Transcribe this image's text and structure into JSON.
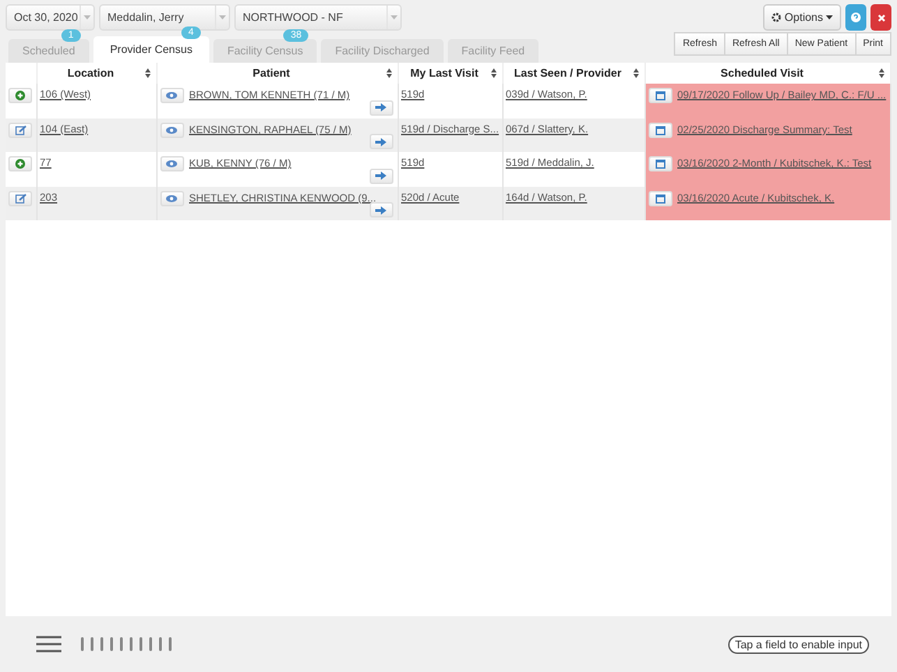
{
  "filters": [
    {
      "value": "Oct 30, 2020"
    },
    {
      "value": "Meddalin, Jerry"
    },
    {
      "value": "NORTHWOOD - NF"
    }
  ],
  "options_button": "Options",
  "tabs": [
    {
      "label": "Scheduled",
      "badge": "1",
      "selected": false
    },
    {
      "label": "Provider Census",
      "badge": "4",
      "selected": true
    },
    {
      "label": "Facility Census",
      "badge": "38",
      "selected": false
    },
    {
      "label": "Facility Discharged",
      "selected": false
    },
    {
      "label": "Facility Feed",
      "selected": false
    }
  ],
  "actions": [
    "Refresh",
    "Refresh All",
    "New Patient",
    "Print"
  ],
  "table": {
    "columns": [
      "Location",
      "Patient",
      "My Last Visit",
      "Last Seen / Provider",
      "Scheduled Visit"
    ],
    "rows": [
      {
        "kind": "add",
        "location": "106 (West)",
        "patient": "BROWN, TOM KENNETH (71 / M)",
        "my_last_visit": "519d",
        "last_seen": "039d / Watson, P.",
        "scheduled_visit": "09/17/2020 Follow Up / Bailey MD, C.: F/U ...",
        "overdue": true
      },
      {
        "kind": "edit",
        "location": "104 (East)",
        "patient": "KENSINGTON, RAPHAEL (75 / M)",
        "my_last_visit": "519d / Discharge S...",
        "last_seen": "067d / Slattery, K.",
        "scheduled_visit": "02/25/2020 Discharge Summary: Test",
        "overdue": true
      },
      {
        "kind": "add",
        "location": "77",
        "patient": "KUB, KENNY (76 / M)",
        "my_last_visit": "519d",
        "last_seen": "519d / Meddalin, J.",
        "scheduled_visit": "03/16/2020 2-Month / Kubitschek, K.: Test",
        "overdue": true
      },
      {
        "kind": "edit",
        "location": "203",
        "patient": "SHETLEY, CHRISTINA KENWOOD (9...",
        "my_last_visit": "520d / Acute",
        "last_seen": "164d / Watson, P.",
        "scheduled_visit": "03/16/2020 Acute / Kubitschek, K.",
        "overdue": true
      }
    ]
  },
  "status_hint": "Tap a field to enable input"
}
